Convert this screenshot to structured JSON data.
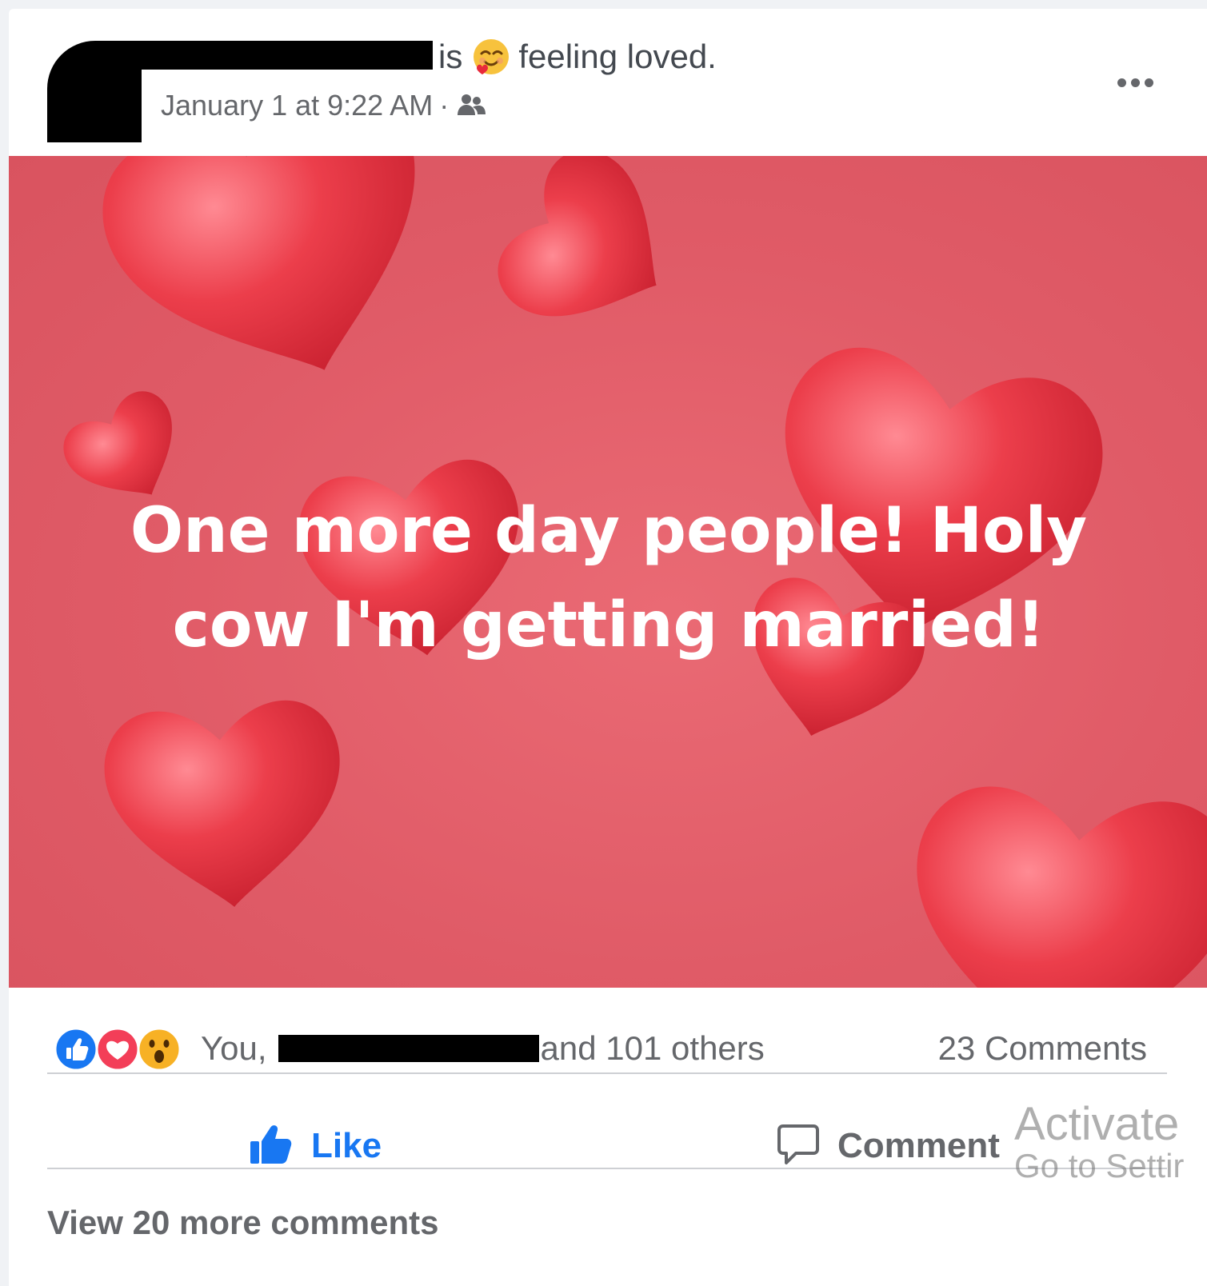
{
  "post": {
    "feeling_prefix": "is",
    "feeling_text": "feeling loved.",
    "feeling_icon": "smiling-face-with-hearts-icon",
    "timestamp": "January 1 at 9:22 AM",
    "separator": "·",
    "audience_icon": "friends-icon",
    "image_text": "One more day people! Holy cow I'm getting married!"
  },
  "reactions": {
    "icons": [
      "like-icon",
      "love-icon",
      "wow-icon"
    ],
    "prefix": "You,",
    "suffix": "and 101 others",
    "comments": "23 Comments"
  },
  "actions": {
    "like_label": "Like",
    "comment_label": "Comment"
  },
  "comments": {
    "view_more": "View 20 more comments"
  },
  "watermark": {
    "line1": "Activate",
    "line2": "Go to Settir"
  },
  "colors": {
    "accent": "#1877f2",
    "secondary_text": "#65676b",
    "image_background": "#e05b67",
    "heart": "#e83a45",
    "love_reaction": "#f33e58",
    "wow_reaction": "#f7b125"
  }
}
